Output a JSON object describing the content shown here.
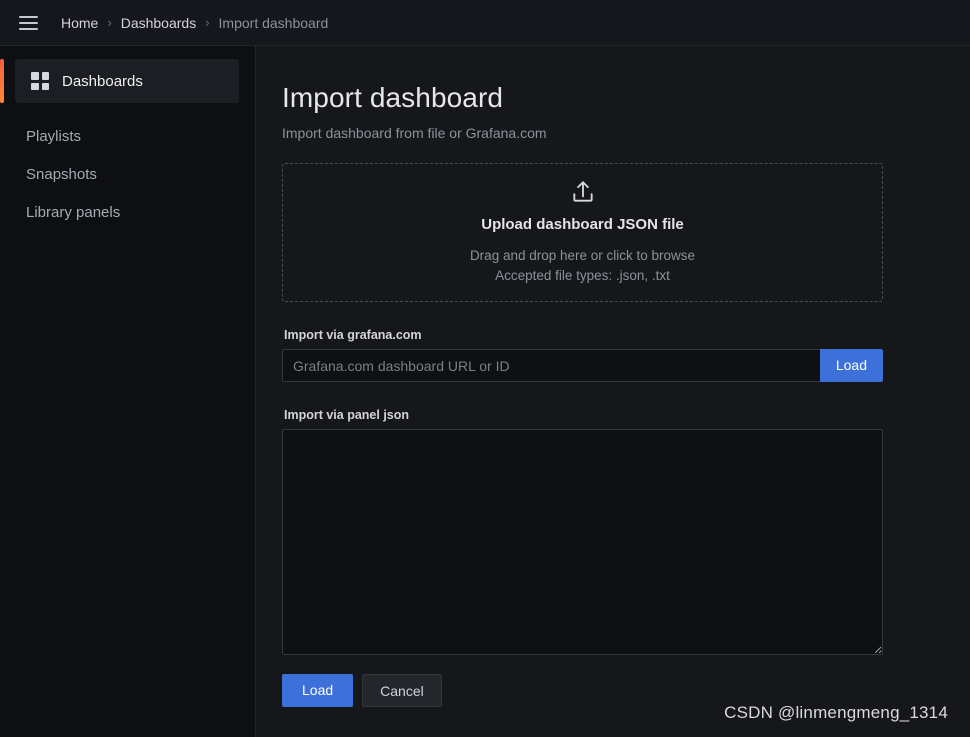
{
  "topbar": {
    "menu_icon": "hamburger-menu-icon",
    "breadcrumb": [
      {
        "label": "Home",
        "current": false
      },
      {
        "label": "Dashboards",
        "current": false
      },
      {
        "label": "Import dashboard",
        "current": true
      }
    ],
    "separator": "›"
  },
  "sidebar": {
    "active_item": {
      "label": "Dashboards",
      "icon": "dashboards-grid-icon",
      "accent_color": "#f55f3e"
    },
    "items": [
      {
        "label": "Playlists"
      },
      {
        "label": "Snapshots"
      },
      {
        "label": "Library panels"
      }
    ]
  },
  "main": {
    "title": "Import dashboard",
    "subtitle": "Import dashboard from file or Grafana.com",
    "dropzone": {
      "icon": "upload-icon",
      "title": "Upload dashboard JSON file",
      "hint": "Drag and drop here or click to browse",
      "accepted": "Accepted file types: .json, .txt"
    },
    "grafana_com": {
      "label": "Import via grafana.com",
      "placeholder": "Grafana.com dashboard URL or ID",
      "value": "",
      "load_label": "Load"
    },
    "panel_json": {
      "label": "Import via panel json",
      "placeholder": "",
      "value": ""
    },
    "actions": {
      "load_label": "Load",
      "cancel_label": "Cancel"
    }
  },
  "watermark": "CSDN @linmengmeng_1314",
  "colors": {
    "primary_blue": "#3d71d9",
    "accent_orange": "#f55f3e",
    "page_bg": "#111217",
    "sidebar_bg": "#0e0f12",
    "content_bg": "#16171b"
  }
}
